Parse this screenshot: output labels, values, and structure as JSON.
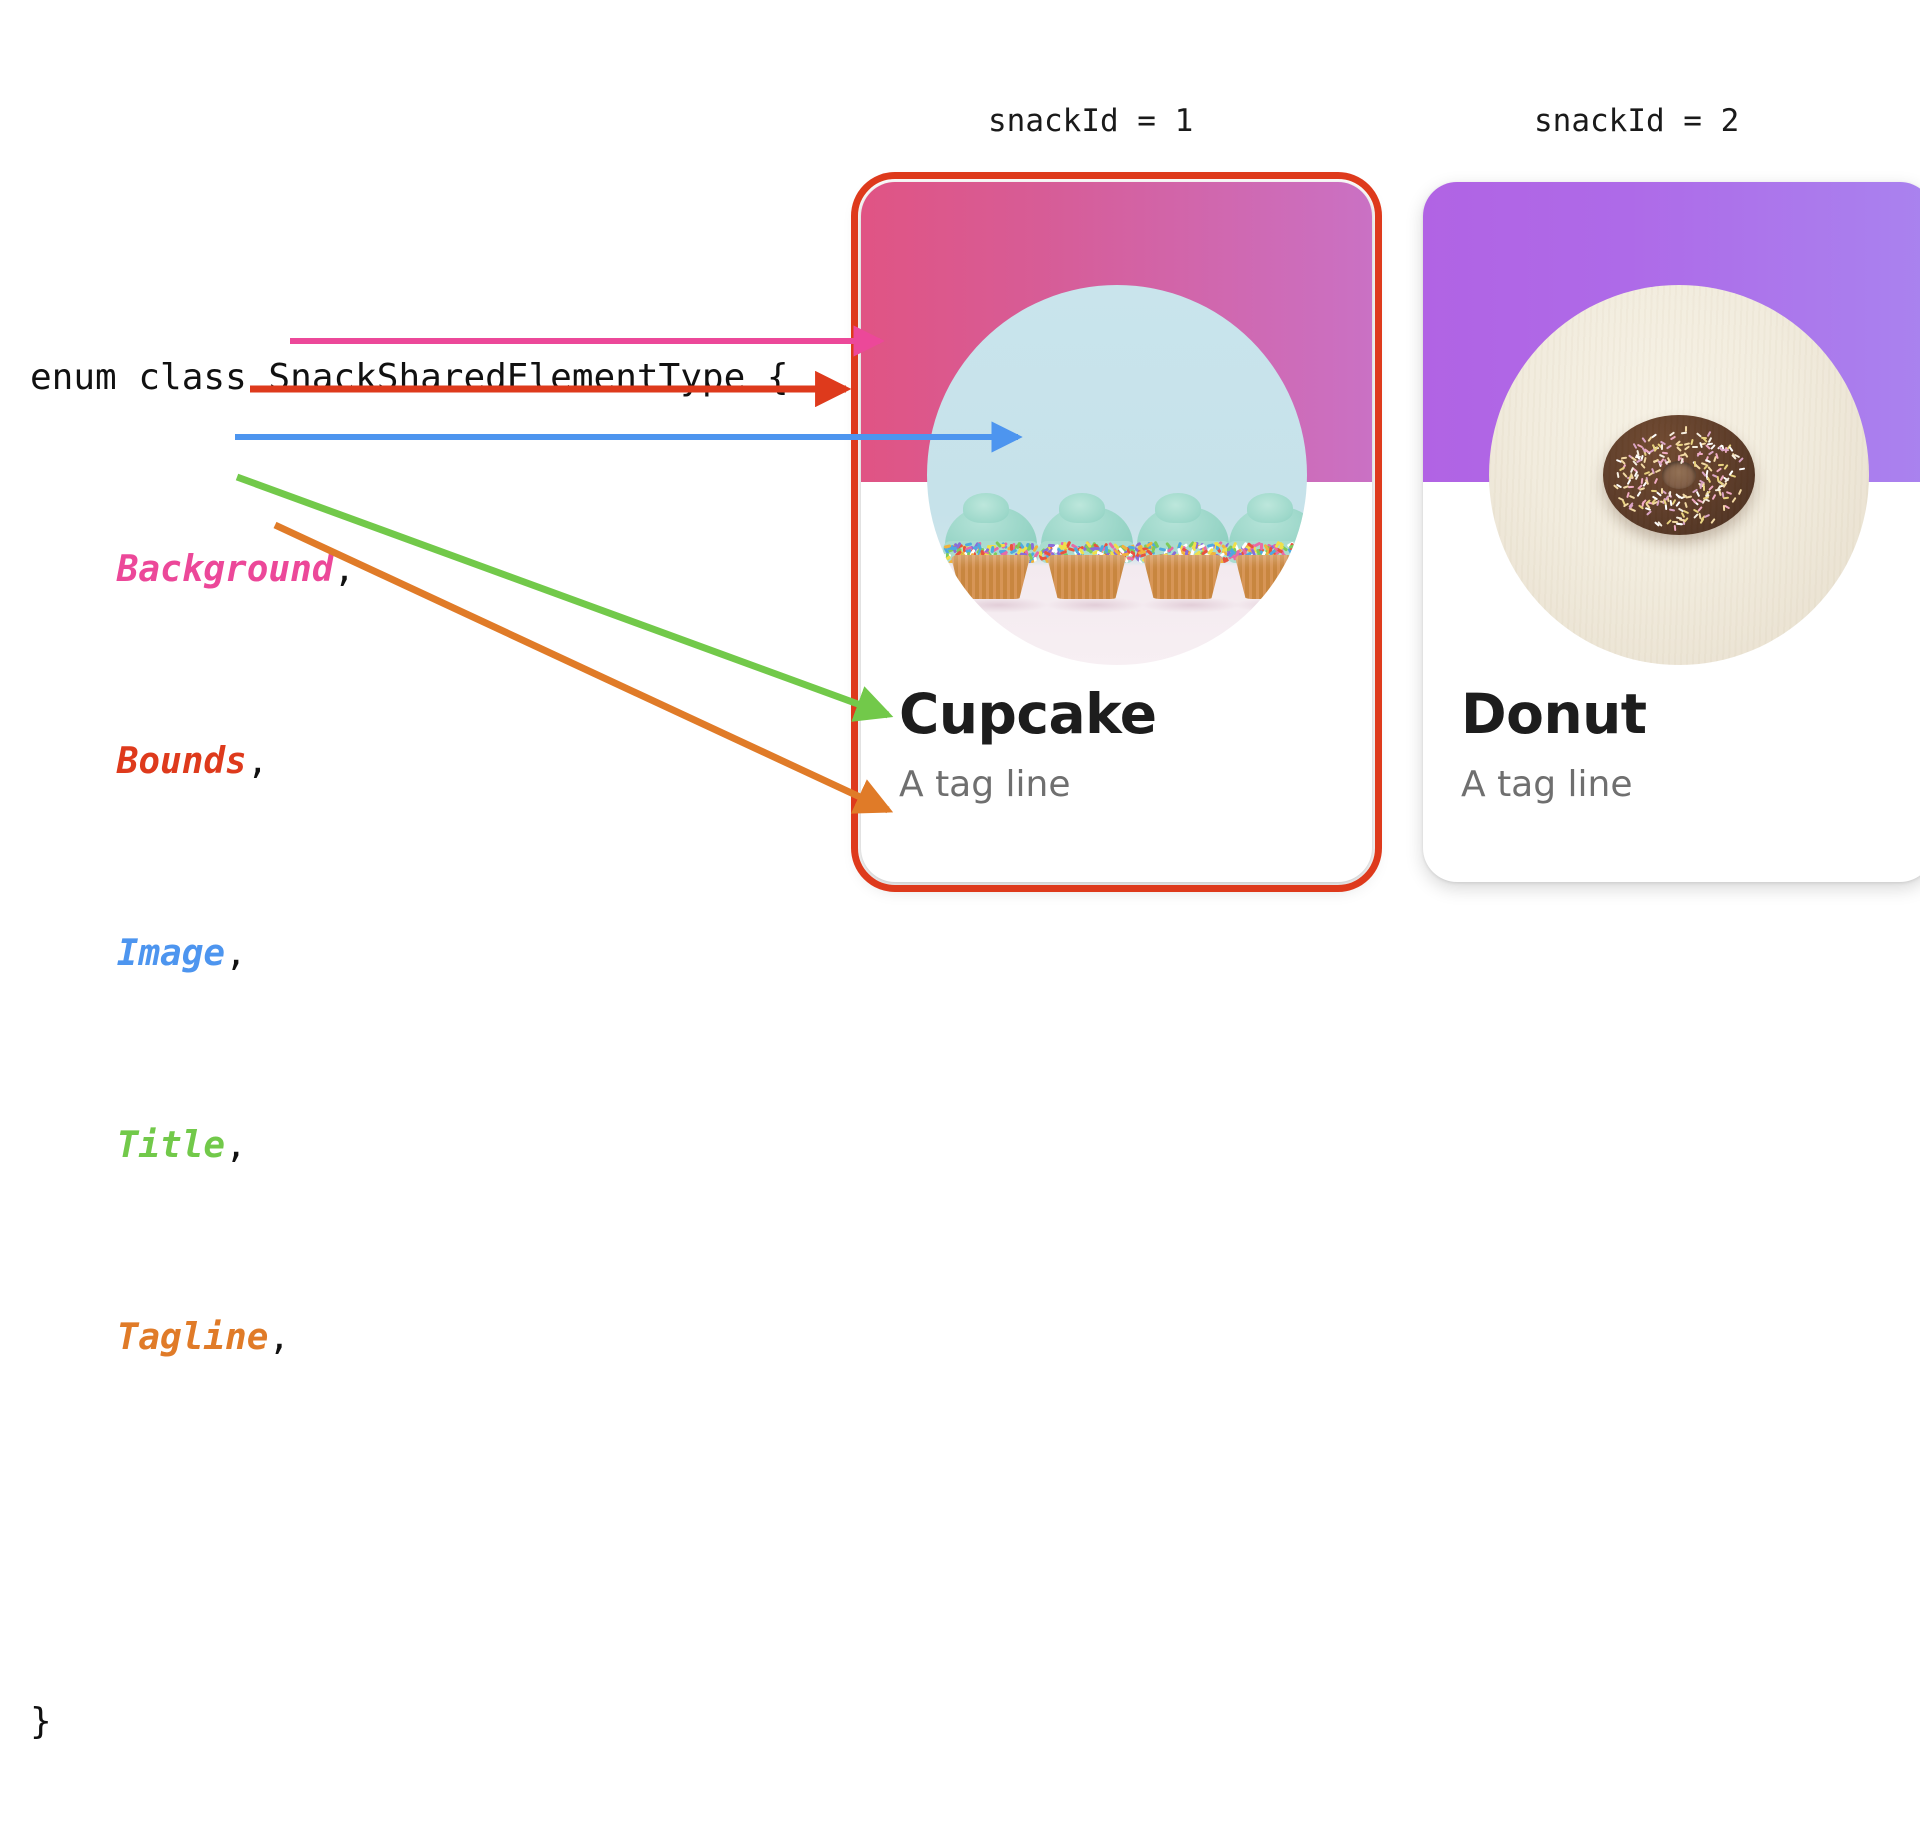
{
  "code": {
    "line_declaration": "enum class SnackSharedElementType {",
    "entries": [
      {
        "name": "Background",
        "comma": ",",
        "color": "#ec4899"
      },
      {
        "name": "Bounds",
        "comma": ",",
        "color": "#de3a1c"
      },
      {
        "name": "Image",
        "comma": ",",
        "color": "#4d95ef"
      },
      {
        "name": "Title",
        "comma": ",",
        "color": "#72c94a"
      },
      {
        "name": "Tagline",
        "comma": ",",
        "color": "#e07b28"
      }
    ],
    "line_close": "}"
  },
  "captions": {
    "card_1": "snackId = 1",
    "card_2": "snackId = 2"
  },
  "cards": [
    {
      "id": 1,
      "title": "Cupcake",
      "tagline": "A tag line",
      "background_gradient_from": "#e05484",
      "background_gradient_to": "#ca71c4",
      "image_name": "cupcake-photo",
      "highlighted": true,
      "bounds_color": "#de3a1c"
    },
    {
      "id": 2,
      "title": "Donut",
      "tagline": "A tag line",
      "background_gradient_from": "#b163e4",
      "background_gradient_to": "#a983ef",
      "image_name": "donut-photo",
      "highlighted": false,
      "bounds_color": "#de3a1c"
    }
  ],
  "annotations": [
    {
      "label": "Background",
      "color": "#ec4899",
      "target": "card-1-background-gradient"
    },
    {
      "label": "Bounds",
      "color": "#de3a1c",
      "target": "card-1-bounds-ring"
    },
    {
      "label": "Image",
      "color": "#4d95ef",
      "target": "card-1-image-circle"
    },
    {
      "label": "Title",
      "color": "#72c94a",
      "target": "card-1-title"
    },
    {
      "label": "Tagline",
      "color": "#e07b28",
      "target": "card-1-tagline"
    }
  ]
}
